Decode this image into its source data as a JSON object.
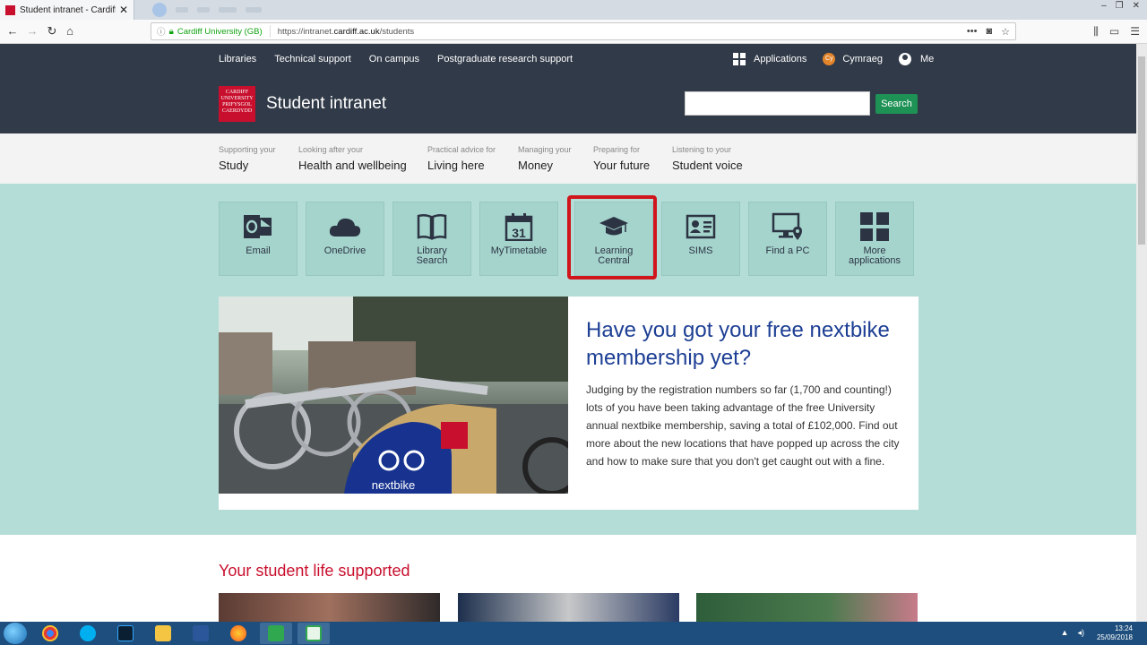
{
  "browser": {
    "tab_title": "Student intranet - Cardiff Univ",
    "tab_close": "✕",
    "org_label": "Cardiff University (GB)",
    "url_prefix": "https://intranet.",
    "url_domain": "cardiff.ac.uk",
    "url_path": "/students",
    "window_controls": [
      "–",
      "❐",
      "✕"
    ]
  },
  "topnav": {
    "links": [
      "Libraries",
      "Technical support",
      "On campus",
      "Postgraduate research support"
    ],
    "applications": "Applications",
    "cy_badge": "Cy",
    "cymraeg": "Cymraeg",
    "me": "Me"
  },
  "header": {
    "logo_lines": [
      "CARDIFF",
      "UNIVERSITY",
      "PRIFYSGOL",
      "CAERDYDD"
    ],
    "title": "Student intranet",
    "search_button": "Search"
  },
  "topics": [
    {
      "small": "Supporting your",
      "big": "Study"
    },
    {
      "small": "Looking after your",
      "big": "Health and wellbeing"
    },
    {
      "small": "Practical advice for",
      "big": "Living here"
    },
    {
      "small": "Managing your",
      "big": "Money"
    },
    {
      "small": "Preparing for",
      "big": "Your future"
    },
    {
      "small": "Listening to your",
      "big": "Student voice"
    }
  ],
  "tiles": [
    {
      "label1": "Email",
      "label2": "",
      "icon": "email-icon"
    },
    {
      "label1": "OneDrive",
      "label2": "",
      "icon": "cloud-icon"
    },
    {
      "label1": "Library",
      "label2": "Search",
      "icon": "book-icon"
    },
    {
      "label1": "MyTimetable",
      "label2": "",
      "icon": "calendar-icon",
      "calendar_day": "31"
    },
    {
      "label1": "Learning",
      "label2": "Central",
      "icon": "graduation-cap-icon"
    },
    {
      "label1": "SIMS",
      "label2": "",
      "icon": "id-card-icon"
    },
    {
      "label1": "Find a PC",
      "label2": "",
      "icon": "computer-icon"
    },
    {
      "label1": "More",
      "label2": "applications",
      "icon": "grid-icon"
    }
  ],
  "feature": {
    "heading": "Have you got your free nextbike membership yet?",
    "body": "Judging by the registration numbers so far (1,700 and counting!) lots of you have been taking advantage of the free University annual nextbike membership, saving a total of £102,000. Find out more about the new locations that have popped up across the city and how to make sure that you don't get caught out with a fine.",
    "image_brand": "nextbike"
  },
  "section_title": "Your student life supported",
  "taskbar": {
    "time": "13:24",
    "date": "25/09/2018"
  },
  "colors": {
    "header_bg": "#313a48",
    "accent_red": "#c8102e",
    "search_green": "#1e9155",
    "teal": "#b4ddd7",
    "heading_blue": "#1d3f94"
  }
}
